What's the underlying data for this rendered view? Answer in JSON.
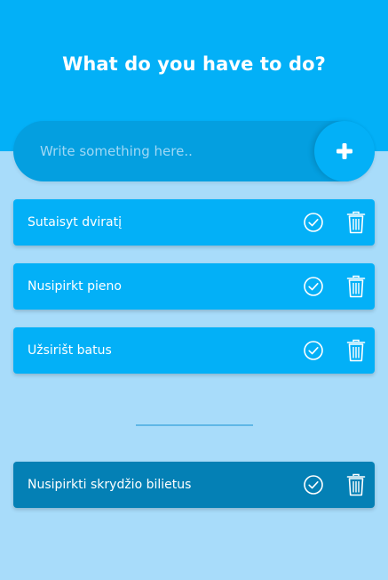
{
  "header": {
    "title": "What do you have to do?"
  },
  "input": {
    "placeholder": "Write something here..",
    "value": "",
    "add_icon": "plus-icon"
  },
  "todo": {
    "items": [
      {
        "label": "Sutaisyt dviratį"
      },
      {
        "label": "Nusipirkt pieno"
      },
      {
        "label": "Užsirišt batus"
      }
    ]
  },
  "completed": {
    "items": [
      {
        "label": "Nusipirkti skrydžio bilietus"
      }
    ]
  },
  "icons": {
    "complete": "check-circle-icon",
    "remove": "trash-icon"
  },
  "colors": {
    "header": "#03b0f7",
    "background": "#a8dcfa",
    "input_bar": "#049fe0",
    "card": "#03b0f7",
    "card_done": "#0480b5",
    "divider": "#5fb7e6"
  }
}
